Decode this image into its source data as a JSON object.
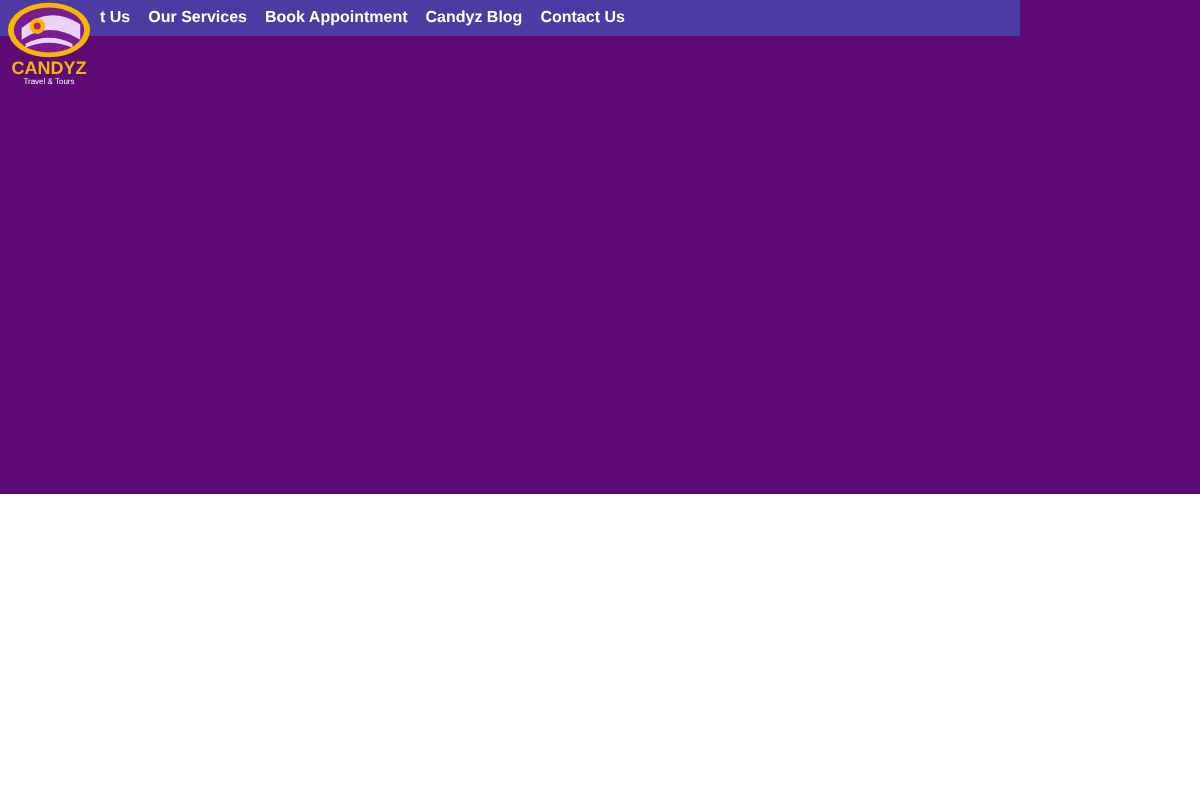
{
  "logo": {
    "name": "CANDYZ",
    "tagline": "Travel & Tours"
  },
  "nav": {
    "items": [
      {
        "label": "t Us"
      },
      {
        "label": "Our Services"
      },
      {
        "label": "Book Appointment"
      },
      {
        "label": "Candyz Blog"
      },
      {
        "label": "Contact Us"
      }
    ]
  }
}
